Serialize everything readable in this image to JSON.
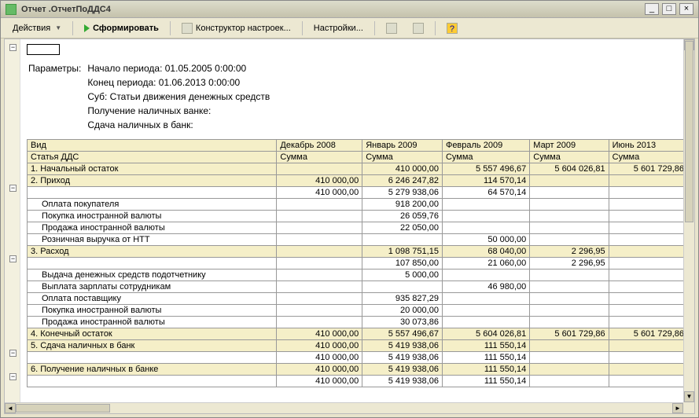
{
  "window": {
    "title": "Отчет .ОтчетПоДДС4"
  },
  "toolbar": {
    "actions": "Действия",
    "run": "Сформировать",
    "designer": "Конструктор настроек...",
    "settings": "Настройки..."
  },
  "params": {
    "label": "Параметры:",
    "r1": "Начало периода: 01.05.2005 0:00:00",
    "r2": "Конец периода: 01.06.2013 0:00:00",
    "r3": "Суб: Статьи движения денежных средств",
    "r4": "Получение наличных ванке:",
    "r5": "Сдача наличных в банк:"
  },
  "grid": {
    "h1": "Вид",
    "h2": "Статья ДДС",
    "periods": [
      "Декабрь 2008",
      "Январь 2009",
      "Февраль 2009",
      "Март 2009",
      "Июнь 2013"
    ],
    "sumlabel": "Сумма",
    "rows": [
      {
        "lbl": "1. Начальный остаток",
        "v": [
          "",
          "410 000,00",
          "5 557 496,67",
          "5 604 026,81",
          "5 601 729,86"
        ],
        "shade": true
      },
      {
        "lbl": "2. Приход",
        "v": [
          "410 000,00",
          "6 246 247,82",
          "114 570,14",
          "",
          ""
        ],
        "shade": true,
        "tree": "-"
      },
      {
        "lbl": "",
        "v": [
          "410 000,00",
          "5 279 938,06",
          "64 570,14",
          "",
          ""
        ]
      },
      {
        "lbl": "Оплата покупателя",
        "v": [
          "",
          "918 200,00",
          "",
          "",
          ""
        ],
        "indent": true
      },
      {
        "lbl": "Покупка иностранной валюты",
        "v": [
          "",
          "26 059,76",
          "",
          "",
          ""
        ],
        "indent": true
      },
      {
        "lbl": "Продажа иностранной валюты",
        "v": [
          "",
          "22 050,00",
          "",
          "",
          ""
        ],
        "indent": true
      },
      {
        "lbl": "Розничная выручка от НТТ",
        "v": [
          "",
          "",
          "50 000,00",
          "",
          ""
        ],
        "indent": true
      },
      {
        "lbl": "3. Расход",
        "v": [
          "",
          "1 098 751,15",
          "68 040,00",
          "2 296,95",
          ""
        ],
        "shade": true,
        "tree": "-"
      },
      {
        "lbl": "",
        "v": [
          "",
          "107 850,00",
          "21 060,00",
          "2 296,95",
          ""
        ]
      },
      {
        "lbl": "Выдача денежных средств подотчетнику",
        "v": [
          "",
          "5 000,00",
          "",
          "",
          ""
        ],
        "indent": true
      },
      {
        "lbl": "Выплата зарплаты сотрудникам",
        "v": [
          "",
          "",
          "46 980,00",
          "",
          ""
        ],
        "indent": true
      },
      {
        "lbl": "Оплата поставщику",
        "v": [
          "",
          "935 827,29",
          "",
          "",
          ""
        ],
        "indent": true
      },
      {
        "lbl": "Покупка иностранной валюты",
        "v": [
          "",
          "20 000,00",
          "",
          "",
          ""
        ],
        "indent": true
      },
      {
        "lbl": "Продажа иностранной валюты",
        "v": [
          "",
          "30 073,86",
          "",
          "",
          ""
        ],
        "indent": true
      },
      {
        "lbl": "4. Конечный остаток",
        "v": [
          "410 000,00",
          "5 557 496,67",
          "5 604 026,81",
          "5 601 729,86",
          "5 601 729,86"
        ],
        "shade": true
      },
      {
        "lbl": "5. Сдача наличных в банк",
        "v": [
          "410 000,00",
          "5 419 938,06",
          "111 550,14",
          "",
          ""
        ],
        "shade": true,
        "tree": "-"
      },
      {
        "lbl": "",
        "v": [
          "410 000,00",
          "5 419 938,06",
          "111 550,14",
          "",
          ""
        ]
      },
      {
        "lbl": "6. Получение наличных в банке",
        "v": [
          "410 000,00",
          "5 419 938,06",
          "111 550,14",
          "",
          ""
        ],
        "shade": true,
        "tree": "-"
      },
      {
        "lbl": "",
        "v": [
          "410 000,00",
          "5 419 938,06",
          "111 550,14",
          "",
          ""
        ]
      }
    ]
  }
}
